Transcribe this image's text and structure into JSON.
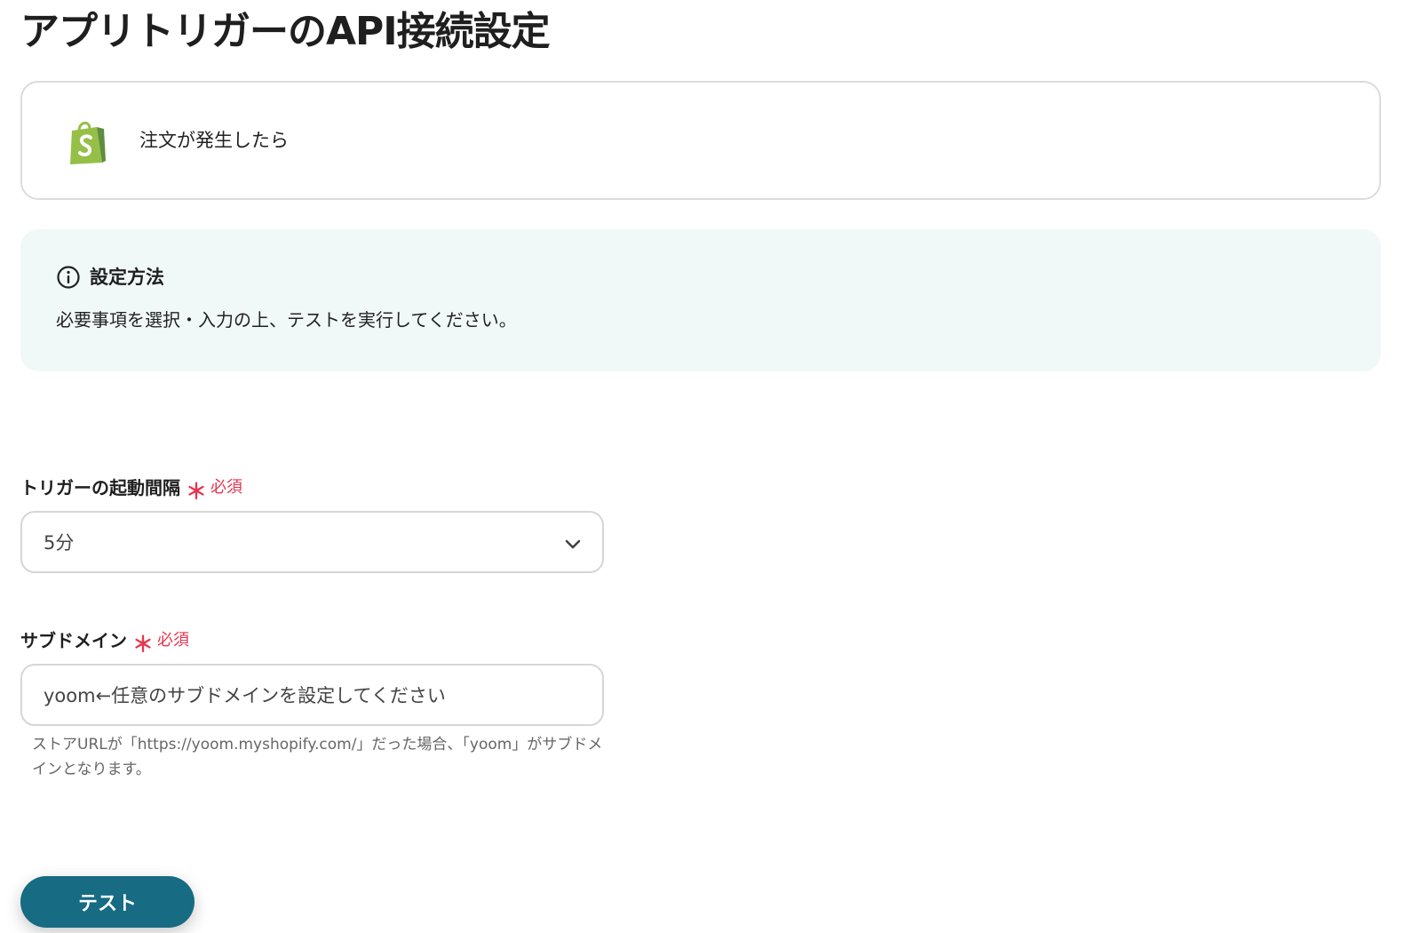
{
  "page": {
    "title": "アプリトリガーのAPI接続設定"
  },
  "trigger": {
    "app_icon": "shopify-bag-icon",
    "label": "注文が発生したら"
  },
  "info": {
    "icon": "info-circle-icon",
    "title": "設定方法",
    "text": "必要事項を選択・入力の上、テストを実行してください。"
  },
  "fields": {
    "interval": {
      "label": "トリガーの起動間隔",
      "required_mark": "＊",
      "required_text": "必須",
      "value": "5分",
      "icon": "chevron-down-icon"
    },
    "subdomain": {
      "label": "サブドメイン",
      "required_mark": "＊",
      "required_text": "必須",
      "value": "yoom←任意のサブドメインを設定してください",
      "help": "ストアURLが「https://yoom.myshopify.com/」だった場合、「yoom」がサブドメインとなります。"
    }
  },
  "actions": {
    "test_label": "テスト"
  },
  "colors": {
    "accent": "#176b82",
    "required": "#e8344e",
    "info_bg": "#f1f9f8",
    "shopify_green": "#95bf47"
  }
}
